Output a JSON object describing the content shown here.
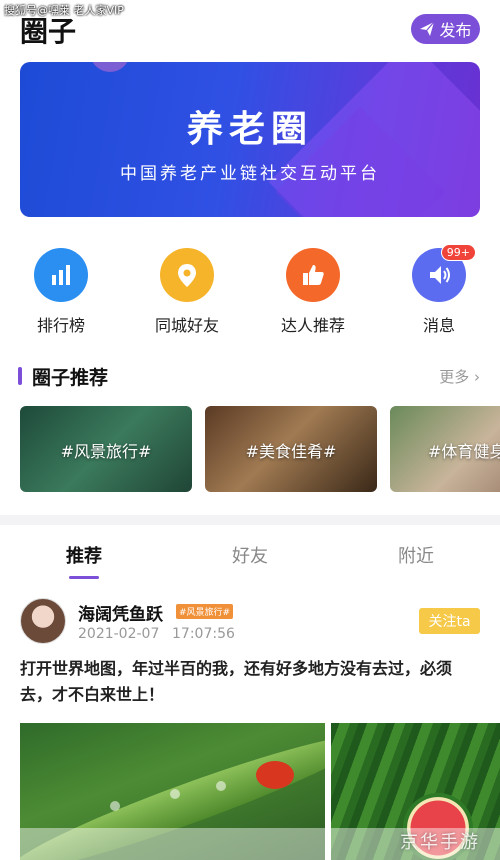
{
  "watermark_top": "搜狐号@嘿莱 老人家VIP",
  "header": {
    "title": "圈子",
    "publish_label": "发布"
  },
  "banner": {
    "title": "养老圈",
    "subtitle": "中国养老产业链社交互动平台"
  },
  "quick_nav": [
    {
      "label": "排行榜",
      "icon": "bar-chart-icon",
      "color": "#2a8ff0"
    },
    {
      "label": "同城好友",
      "icon": "location-pin-icon",
      "color": "#f6b42a"
    },
    {
      "label": "达人推荐",
      "icon": "thumbs-up-icon",
      "color": "#f4682a"
    },
    {
      "label": "消息",
      "icon": "speaker-icon",
      "color": "#5b6cf0",
      "badge": "99+"
    }
  ],
  "section": {
    "title": "圈子推荐",
    "more": "更多"
  },
  "circles": [
    {
      "label": "#风景旅行#"
    },
    {
      "label": "#美食佳肴#"
    },
    {
      "label": "#体育健身"
    }
  ],
  "tabs": [
    {
      "label": "推荐",
      "active": true
    },
    {
      "label": "好友",
      "active": false
    },
    {
      "label": "附近",
      "active": false
    }
  ],
  "post": {
    "author": "海阔凭鱼跃",
    "tag": "#风景旅行#",
    "date": "2021-02-07",
    "time": "17:07:56",
    "follow_label": "关注ta",
    "text": "打开世界地图，年过半百的我，还有好多地方没有去过，必须去，才不白来世上！"
  },
  "watermark_bottom": "京华手游",
  "colors": {
    "accent": "#7b4fd8",
    "follow": "#f7c948",
    "tag": "#f0913a"
  }
}
